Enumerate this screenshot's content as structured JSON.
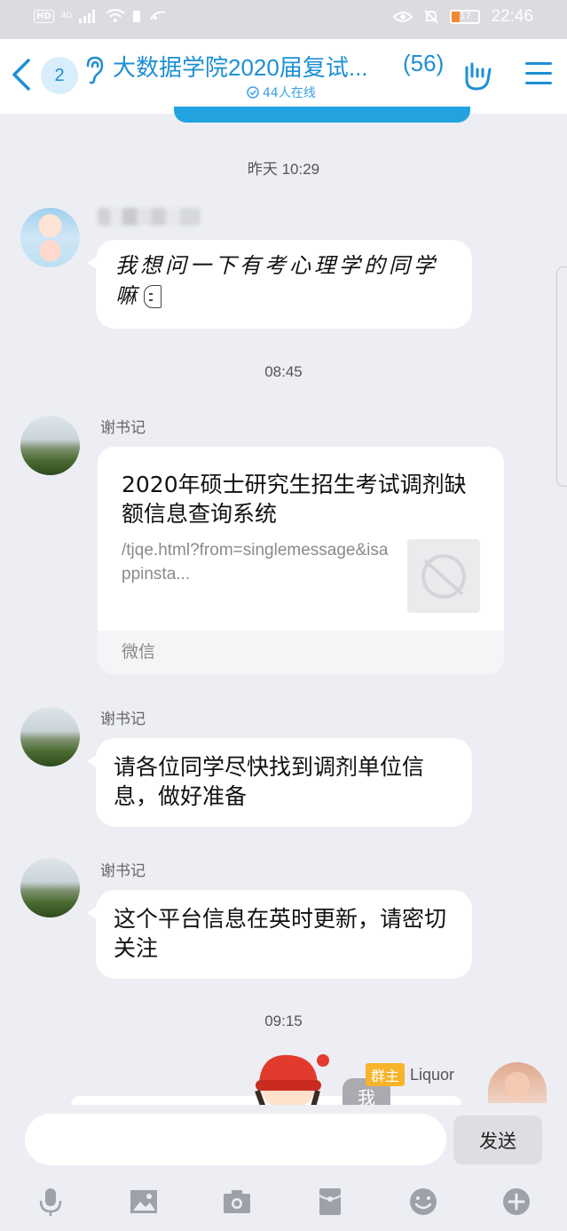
{
  "status_bar": {
    "hd": "HD",
    "network": "4G",
    "time": "22:46",
    "battery": "17"
  },
  "header": {
    "unread_count": "2",
    "title": "大数据学院2020届复试...",
    "member_count": "(56)",
    "online": "44人在线",
    "accent_color": "#1d8fd4"
  },
  "messages": {
    "ts1": "昨天 10:29",
    "msg1_text": "我想问一下有考心理学的同学嘛",
    "ts2": "08:45",
    "msg2_sender": "谢书记",
    "card": {
      "title": "2020年硕士研究生招生考试调剂缺额信息查询系统",
      "desc": "/tjqe.html?from=singlemessage&isappinsta...",
      "source": "微信"
    },
    "msg3_sender": "谢书记",
    "msg3_text": "请各位同学尽快找到调剂单位信息，做好准备",
    "msg4_sender": "谢书记",
    "msg4_text": "这个平台信息在英时更新，请密切关注",
    "ts3": "09:15",
    "msg5_role": "群主",
    "msg5_sender": "Liquor",
    "me_chip": "我"
  },
  "input_bar": {
    "placeholder": "",
    "send_label": "发送"
  },
  "toolbar_icons": [
    "microphone-icon",
    "image-icon",
    "camera-icon",
    "red-packet-icon",
    "emoji-icon",
    "plus-icon"
  ]
}
